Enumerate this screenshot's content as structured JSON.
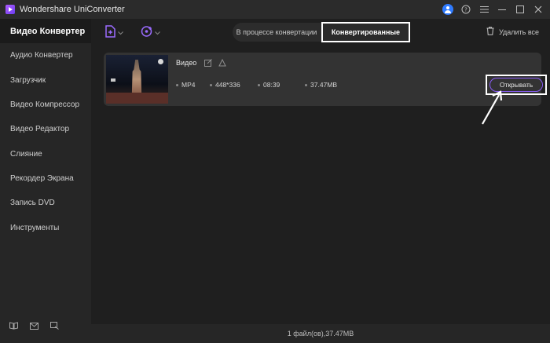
{
  "app": {
    "title": "Wondershare UniConverter"
  },
  "sidebar": {
    "items": [
      {
        "label": "Видео Конвертер"
      },
      {
        "label": "Аудио Конвертер"
      },
      {
        "label": "Загрузчик"
      },
      {
        "label": "Видео Компрессор"
      },
      {
        "label": "Видео Редактор"
      },
      {
        "label": "Слияние"
      },
      {
        "label": "Рекордер Экрана"
      },
      {
        "label": "Запись DVD"
      },
      {
        "label": "Инструменты"
      }
    ],
    "bottom_icons": [
      "book-icon",
      "mail-icon",
      "feedback-icon"
    ]
  },
  "toolbar": {
    "tabs": [
      {
        "label": "В процессе конвертации"
      },
      {
        "label": "Конвертированные"
      }
    ],
    "delete_all_label": "Удалить все"
  },
  "file": {
    "name": "Видео",
    "format": "MP4",
    "resolution": "448*336",
    "duration": "08:39",
    "size": "37.47MB",
    "open_label": "Открывать"
  },
  "status": {
    "text": "1 файл(ов),37.47MB"
  },
  "colors": {
    "accent": "#8a5cf6",
    "brand": "#2f7bff",
    "highlight_box": "#ffffff"
  }
}
